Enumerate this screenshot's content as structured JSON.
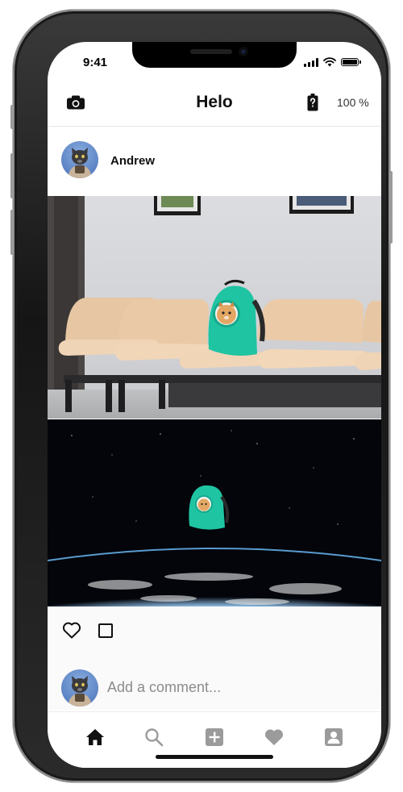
{
  "status_bar": {
    "time": "9:41"
  },
  "header": {
    "title": "Helo",
    "camera_icon": "camera-icon",
    "battery_icon": "battery-question-icon",
    "battery_percent": "100 %"
  },
  "post": {
    "author_name": "Andrew",
    "avatar_icon": "cat-avatar",
    "images": [
      "cat-backpack-waiting-room-photo",
      "cat-backpack-space-earth-photo"
    ],
    "actions": {
      "like_icon": "heart-outline-icon",
      "comment_icon": "square-outline-icon"
    }
  },
  "comment": {
    "placeholder": "Add a comment...",
    "value": ""
  },
  "tab_bar": {
    "items": [
      {
        "icon": "home-icon",
        "active": true
      },
      {
        "icon": "search-icon",
        "active": false
      },
      {
        "icon": "add-square-icon",
        "active": false
      },
      {
        "icon": "heart-icon",
        "active": false
      },
      {
        "icon": "profile-icon",
        "active": false
      }
    ]
  },
  "colors": {
    "active_tab": "#111111",
    "inactive_tab": "#9b9b9b",
    "backpack_teal": "#1ec3a0",
    "chair_peach": "#e8c7a6"
  }
}
